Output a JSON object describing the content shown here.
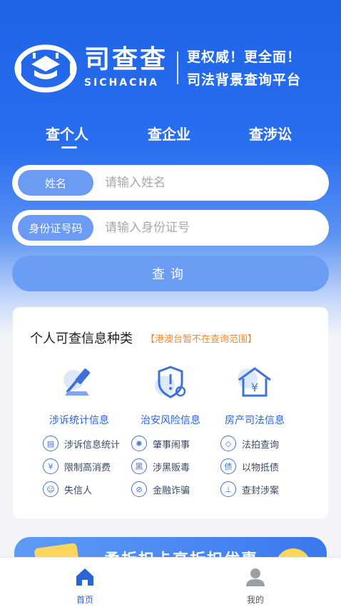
{
  "brand": {
    "logo_cn": "司查查",
    "logo_en": "SICHACHA",
    "slogan_line1": "更权威！更全面！",
    "slogan_line2": "司法背景查询平台"
  },
  "tabs": [
    {
      "label": "查个人",
      "active": true
    },
    {
      "label": "查企业",
      "active": false
    },
    {
      "label": "查涉讼",
      "active": false
    }
  ],
  "form": {
    "name_label": "姓名",
    "name_placeholder": "请输入姓名",
    "id_label": "身份证号码",
    "id_placeholder": "请输入身份证号",
    "submit_label": "查询"
  },
  "info_card": {
    "title": "个人可查信息种类",
    "note": "【港澳台暂不在查询范围】",
    "categories": [
      {
        "label": "涉诉统计信息",
        "icon": "gavel-icon"
      },
      {
        "label": "治安风险信息",
        "icon": "shield-alert-icon"
      },
      {
        "label": "房产司法信息",
        "icon": "house-yen-icon"
      }
    ],
    "items": [
      {
        "label": "涉诉信息统计",
        "icon": "document-icon",
        "glyph": "▤"
      },
      {
        "label": "肇事闹事",
        "icon": "crowd-icon",
        "glyph": "✺"
      },
      {
        "label": "法拍查询",
        "icon": "hammer-icon",
        "glyph": "◇"
      },
      {
        "label": "限制高消费",
        "icon": "restrict-icon",
        "glyph": "¥"
      },
      {
        "label": "涉黑贩毒",
        "icon": "black-icon",
        "glyph": "黑"
      },
      {
        "label": "以物抵债",
        "icon": "debt-icon",
        "glyph": "债"
      },
      {
        "label": "失信人",
        "icon": "person-icon",
        "glyph": "☺"
      },
      {
        "label": "金融诈骗",
        "icon": "fraud-icon",
        "glyph": "⊘"
      },
      {
        "label": "查封涉案",
        "icon": "seal-icon",
        "glyph": "⊥"
      }
    ]
  },
  "banner": {
    "text": "柔折扣卡高折扣优惠"
  },
  "bottom_nav": [
    {
      "label": "首页",
      "icon": "home-icon",
      "active": true
    },
    {
      "label": "我的",
      "icon": "user-icon",
      "active": false
    }
  ],
  "colors": {
    "primary": "#2a6ff0",
    "accent_orange": "#f08a2c",
    "label_blue": "#2a64d6"
  }
}
